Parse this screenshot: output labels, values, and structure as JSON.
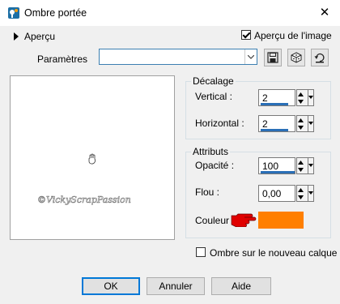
{
  "window": {
    "title": "Ombre portée",
    "close_glyph": "✕"
  },
  "preview_section": {
    "expander_label": "Aperçu",
    "show_image_label": "Aperçu de l'image",
    "show_image_checked": true,
    "watermark_text": "©VickyScrapPassion"
  },
  "presets": {
    "label": "Paramètres",
    "value": ""
  },
  "decalage": {
    "title": "Décalage",
    "vertical_label": "Vertical :",
    "vertical_value": "2",
    "horizontal_label": "Horizontal :",
    "horizontal_value": "2"
  },
  "attributs": {
    "title": "Attributs",
    "opacite_label": "Opacité :",
    "opacite_value": "100",
    "flou_label": "Flou :",
    "flou_value": "0,00",
    "couleur_label": "Couleur",
    "couleur_hex": "#ff7f00"
  },
  "new_layer": {
    "label": "Ombre sur le nouveau calque",
    "checked": false
  },
  "buttons": {
    "ok": "OK",
    "annuler": "Annuler",
    "aide": "Aide"
  },
  "colors": {
    "accent": "#0078d7",
    "spin_bar": "#2a6fb7",
    "swatch": "#ff7f00",
    "pointer": "#e00000"
  }
}
